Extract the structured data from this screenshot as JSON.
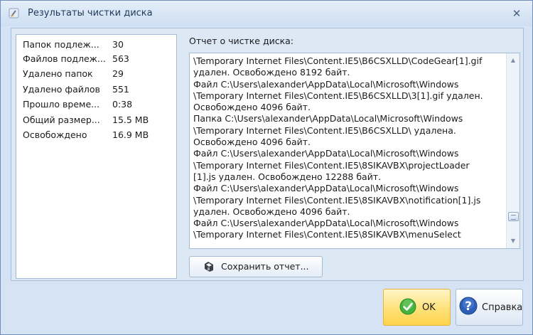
{
  "window": {
    "title": "Результаты чистки диска",
    "close_symbol": "✕"
  },
  "stats": [
    {
      "label": "Папок подлеж...",
      "value": "30"
    },
    {
      "label": "Файлов подлеж...",
      "value": "563"
    },
    {
      "label": "Удалено папок",
      "value": "29"
    },
    {
      "label": "Удалено файлов",
      "value": "551"
    },
    {
      "label": "Прошло време...",
      "value": "0:38"
    },
    {
      "label": "Общий размер...",
      "value": "15.5 MB"
    },
    {
      "label": "Освобождено",
      "value": "16.9 MB"
    }
  ],
  "report": {
    "label": "Отчет о чистке диска:",
    "text": "\\Temporary Internet Files\\Content.IE5\\B6CSXLLD\\CodeGear[1].gif\nудален. Освобождено 8192 байт.\nФайл C:\\Users\\alexander\\AppData\\Local\\Microsoft\\Windows\n\\Temporary Internet Files\\Content.IE5\\B6CSXLLD\\3[1].gif удален.\nОсвобождено 4096 байт.\nПапка C:\\Users\\alexander\\AppData\\Local\\Microsoft\\Windows\n\\Temporary Internet Files\\Content.IE5\\B6CSXLLD\\ удалена.\nОсвобождено 4096 байт.\nФайл C:\\Users\\alexander\\AppData\\Local\\Microsoft\\Windows\n\\Temporary Internet Files\\Content.IE5\\8SIKAVBX\\projectLoader\n[1].js удален. Освобождено 12288 байт.\nФайл C:\\Users\\alexander\\AppData\\Local\\Microsoft\\Windows\n\\Temporary Internet Files\\Content.IE5\\8SIKAVBX\\notification[1].js\nудален. Освобождено 4096 байт.\nФайл C:\\Users\\alexander\\AppData\\Local\\Microsoft\\Windows\n\\Temporary Internet Files\\Content.IE5\\8SIKAVBX\\menuSelect"
  },
  "buttons": {
    "save": "Сохранить отчет...",
    "ok": "OK",
    "help": "Справка"
  },
  "icons": {
    "app": "broom-clean-icon",
    "save": "save-disk-icon",
    "ok": "green-check-icon",
    "help": "blue-question-icon"
  },
  "colors": {
    "ok_accent": "#ffd34b",
    "check_green": "#3aa335",
    "help_blue": "#2d5fb8"
  }
}
